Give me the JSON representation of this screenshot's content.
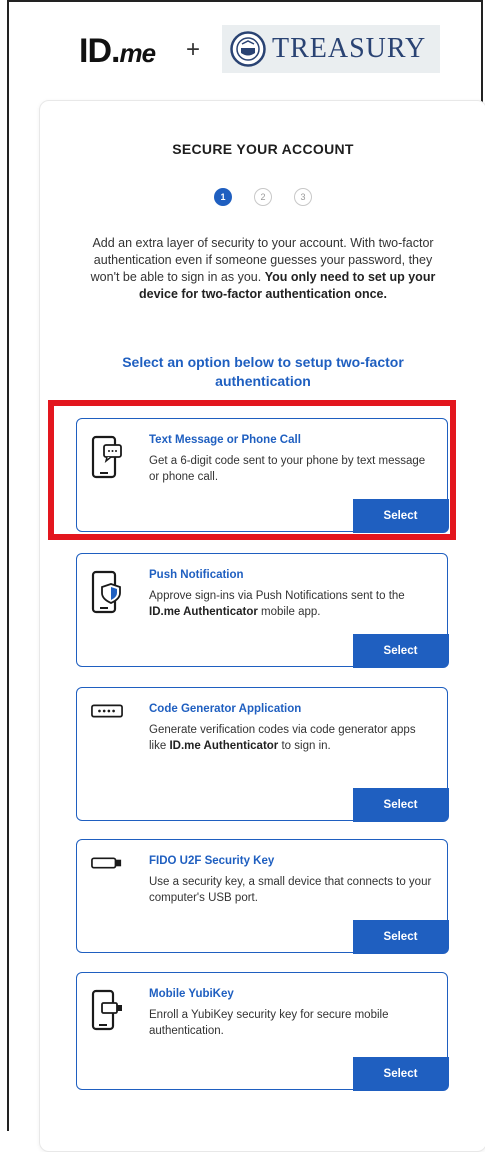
{
  "header": {
    "idme_logo_main": "ID",
    "idme_logo_dot": ".",
    "idme_logo_me": "me",
    "plus": "+",
    "treasury_text": "TREASURY"
  },
  "page": {
    "title": "SECURE YOUR ACCOUNT",
    "steps": [
      "1",
      "2",
      "3"
    ],
    "intro_text": "Add an extra layer of security to your account. With two-factor authentication even if someone guesses your password, they won't be able to sign in as you.",
    "intro_bold": "You only need to set up your device for two-factor authentication once.",
    "subhead": "Select an option below to setup two-factor authentication"
  },
  "options": [
    {
      "title": "Text Message or Phone Call",
      "desc": "Get a 6-digit code sent to your phone by text message or phone call.",
      "button": "Select",
      "icon": "phone-chat-icon"
    },
    {
      "title": "Push Notification",
      "desc_pre": "Approve sign-ins via Push Notifications sent to the ",
      "desc_bold": "ID.me Authenticator",
      "desc_post": " mobile app.",
      "button": "Select",
      "icon": "phone-shield-icon"
    },
    {
      "title": "Code Generator Application",
      "desc_pre": "Generate verification codes via code generator apps like ",
      "desc_bold": "ID.me Authenticator",
      "desc_post": " to sign in.",
      "button": "Select",
      "icon": "password-dots-icon"
    },
    {
      "title": "FIDO U2F Security Key",
      "desc": "Use a security key, a small device that connects to your computer's USB port.",
      "button": "Select",
      "icon": "usb-key-icon"
    },
    {
      "title": "Mobile YubiKey",
      "desc": "Enroll a YubiKey security key for secure mobile authentication.",
      "button": "Select",
      "icon": "phone-key-icon"
    }
  ],
  "colors": {
    "accent": "#1f5fc0",
    "highlight": "#e3161e"
  }
}
